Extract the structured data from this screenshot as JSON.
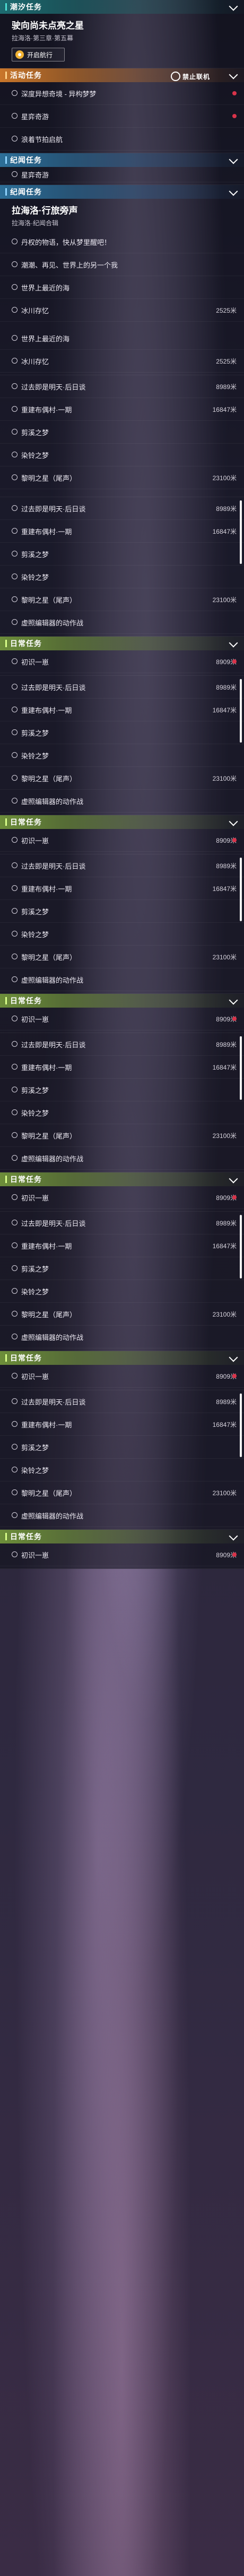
{
  "tide": {
    "header": "潮汐任务",
    "title": "驶向尚未点亮之星",
    "subtitle": "拉海洛·第三章·第五幕",
    "nav_label": "开启航行"
  },
  "event": {
    "header": "活动任务",
    "logo_text": "禁止联机",
    "items": [
      "深度异想奇境 - 异构梦梦",
      "星弈奇游",
      "浪着节拍启航"
    ]
  },
  "era1": {
    "header": "纪闻任务",
    "partial": "星弈奇游"
  },
  "era2": {
    "header": "纪闻任务",
    "title": "拉海洛·行旅旁声",
    "subtitle": "拉海洛·纪闻合辑",
    "items": [
      {
        "label": "丹权的物语，快从梦里醒吧！",
        "dist": ""
      },
      {
        "label": "潮潮、再见、世界上的另一个我",
        "dist": ""
      },
      {
        "label": "世界上最近的海",
        "dist": ""
      },
      {
        "label": "冰川存忆",
        "dist": "2525米"
      }
    ]
  },
  "era3": {
    "items": [
      {
        "label": "世界上最近的海",
        "dist": ""
      },
      {
        "label": "冰川存忆",
        "dist": "2525米"
      }
    ]
  },
  "list_a": [
    {
      "label": "过去即是明天·后日谈",
      "dist": "8989米"
    },
    {
      "label": "重建布偶村·一期",
      "dist": "16847米"
    },
    {
      "label": "剪溪之梦",
      "dist": ""
    },
    {
      "label": "染铃之梦",
      "dist": ""
    },
    {
      "label": "黎明之星（尾声）",
      "dist": "23100米"
    }
  ],
  "list_b": [
    {
      "label": "过去即是明天·后日谈",
      "dist": "8989米"
    },
    {
      "label": "重建布偶村·一期",
      "dist": "16847米"
    },
    {
      "label": "剪溪之梦",
      "dist": ""
    },
    {
      "label": "染铃之梦",
      "dist": ""
    },
    {
      "label": "黎明之星（尾声）",
      "dist": "23100米"
    },
    {
      "label": "虚照编辑器的动作战",
      "dist": ""
    }
  ],
  "daily": {
    "header": "日常任务",
    "first_item": "初识一崽",
    "first_dist": "8909米"
  }
}
